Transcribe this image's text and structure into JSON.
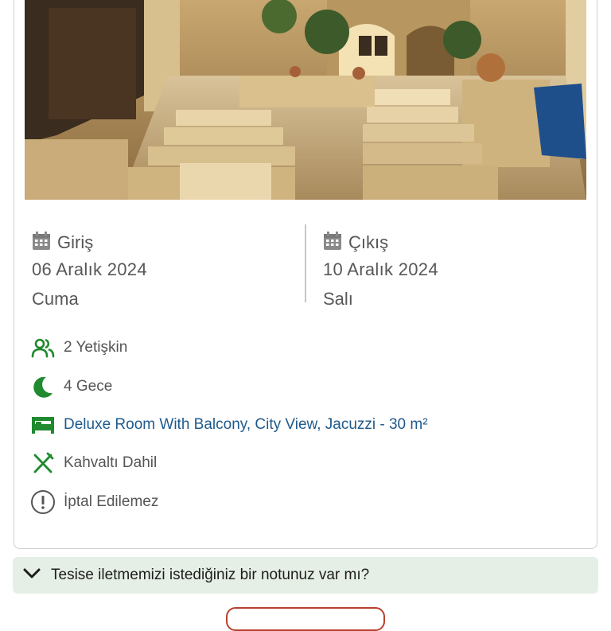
{
  "hero": {
    "image": "hotel-courtyard-photo"
  },
  "checkin": {
    "label": "Giriş",
    "date": "06 Aralık 2024",
    "day": "Cuma"
  },
  "checkout": {
    "label": "Çıkış",
    "date": "10 Aralık 2024",
    "day": "Salı"
  },
  "details": {
    "guests": "2 Yetişkin",
    "nights": "4 Gece",
    "room": "Deluxe Room With Balcony, City View, Jacuzzi - 30 m²",
    "board": "Kahvaltı Dahil",
    "cancellation": "İptal Edilemez"
  },
  "note": {
    "prompt": "Tesise iletmemizi istediğiniz bir notunuz var mı?"
  },
  "colors": {
    "green": "#1f8a2e",
    "link": "#1f5a8c",
    "note_bg": "#e6efe6",
    "accent_red": "#b8402e"
  },
  "icons": [
    "calendar-icon",
    "users-icon",
    "moon-icon",
    "bed-icon",
    "cutlery-icon",
    "alert-circle-icon",
    "chevron-down-icon"
  ]
}
